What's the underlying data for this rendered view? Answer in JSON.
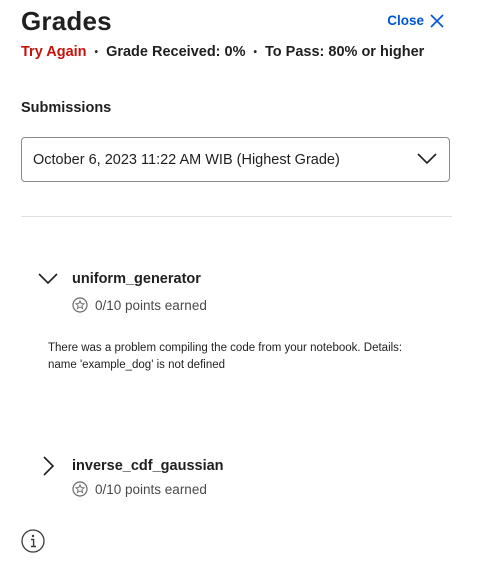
{
  "header": {
    "title": "Grades",
    "close_label": "Close"
  },
  "status": {
    "result": "Try Again",
    "grade_received": "Grade Received: 0%",
    "to_pass": "To Pass: 80% or higher",
    "separator": "•"
  },
  "submissions": {
    "label": "Submissions",
    "selected": "October 6, 2023 11:22 AM WIB (Highest Grade)"
  },
  "items": [
    {
      "name": "uniform_generator",
      "points": "0/10 points earned",
      "expanded": true,
      "feedback": [
        "There was a problem compiling the code from your notebook. Details:",
        "name 'example_dog' is not defined"
      ]
    },
    {
      "name": "inverse_cdf_gaussian",
      "points": "0/10 points earned",
      "expanded": false
    }
  ],
  "colors": {
    "fail": "#c4130a",
    "link": "#0056d2",
    "border": "#8a8a8a"
  },
  "icons": [
    "close-icon",
    "chevron-down-icon",
    "star-badge-icon",
    "chevron-right-icon",
    "info-icon"
  ]
}
